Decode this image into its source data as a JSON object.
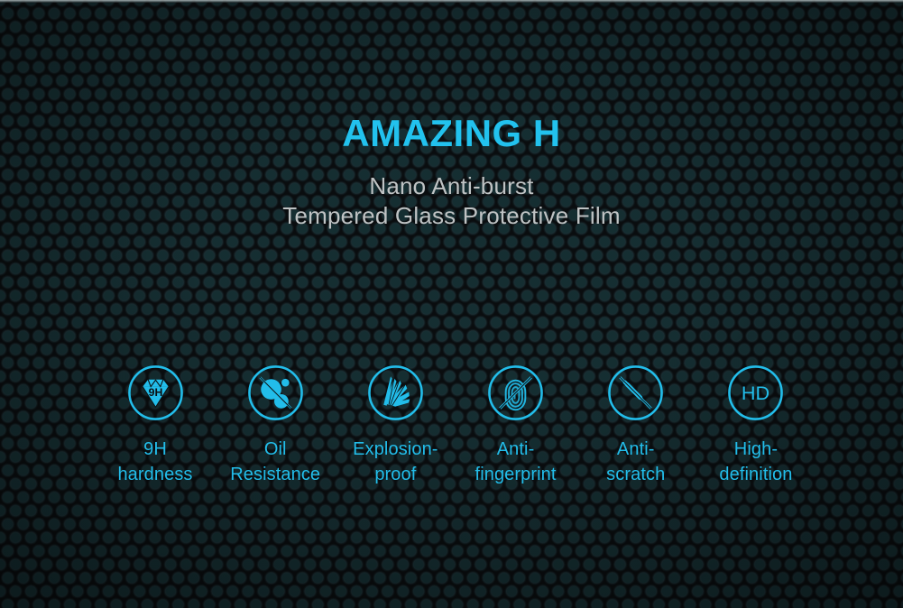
{
  "poster": {
    "title": "AMAZING H",
    "subtitle_lines": [
      "Nano Anti-burst",
      "Tempered Glass Protective Film"
    ],
    "colors": {
      "accent_cyan": "#22c2ee",
      "label_cyan": "#22bdea",
      "subtitle_gray": "#bfc3c4",
      "background_dark": "#0a0d0f",
      "hex_line_teal": "#1a464e"
    },
    "features": [
      {
        "icon": "9h-diamond-icon",
        "badge_text": "9H",
        "label": "9H\nhardness"
      },
      {
        "icon": "oil-droplet-icon",
        "badge_text": "",
        "label": "Oil\nResistance"
      },
      {
        "icon": "shattered-glass-icon",
        "badge_text": "",
        "label": "Explosion-\nproof"
      },
      {
        "icon": "fingerprint-blocked-icon",
        "badge_text": "",
        "label": "Anti-\nfingerprint"
      },
      {
        "icon": "knife-blocked-icon",
        "badge_text": "",
        "label": "Anti-\nscratch"
      },
      {
        "icon": "hd-icon",
        "badge_text": "HD",
        "label": "High-\ndefinition"
      }
    ]
  }
}
